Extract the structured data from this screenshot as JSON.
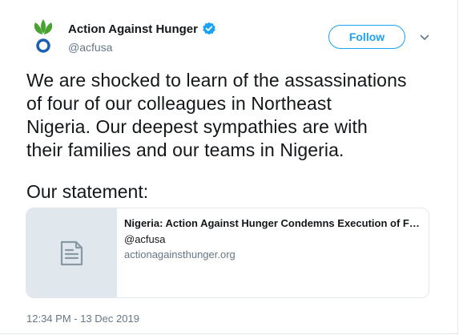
{
  "account": {
    "name": "Action Against Hunger",
    "handle": "@acfusa",
    "verified_icon": "verified-badge-icon",
    "brand_green": "#48a22f",
    "brand_blue": "#1a5fb4"
  },
  "follow": {
    "label": "Follow"
  },
  "tweet": {
    "text": "We are shocked to learn of the assassinations\nof four of our colleagues in Northeast\nNigeria. Our deepest sympathies are with\ntheir families and our teams in Nigeria.",
    "statement": "Our statement:"
  },
  "card": {
    "title": "Nigeria: Action Against Hunger Condemns Execution of Fo...",
    "handle": "@acfusa",
    "domain": "actionagainsthunger.org",
    "thumbnail_icon": "document-icon"
  },
  "timestamp": "12:34 PM - 13 Dec 2019",
  "colors": {
    "accent": "#1da1f2",
    "text": "#14171a",
    "secondary": "#657786",
    "border": "#e1e8ed"
  }
}
